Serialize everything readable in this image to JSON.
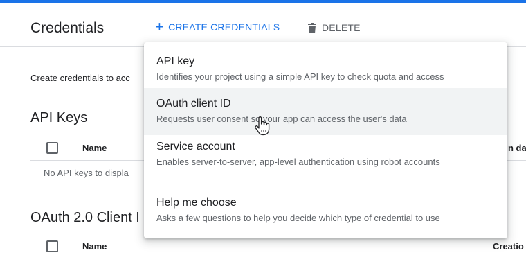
{
  "header": {
    "title": "Credentials",
    "create_label": "CREATE CREDENTIALS",
    "create_icon": "plus-icon",
    "delete_label": "DELETE",
    "delete_icon": "trash-icon"
  },
  "page": {
    "intro_text": "Create credentials to acc",
    "api_keys": {
      "heading": "API Keys",
      "columns": [
        "Name",
        "n da"
      ],
      "empty_text": "No API keys to displa"
    },
    "oauth": {
      "heading": "OAuth 2.0 Client I",
      "columns": [
        "Name",
        "Creatio"
      ]
    }
  },
  "menu": {
    "items": [
      {
        "title": "API key",
        "description": "Identifies your project using a simple API key to check quota and access"
      },
      {
        "title": "OAuth client ID",
        "description": "Requests user consent so your app can access the user's data"
      },
      {
        "title": "Service account",
        "description": "Enables server-to-server, app-level authentication using robot accounts"
      },
      {
        "title": "Help me choose",
        "description": "Asks a few questions to help you decide which type of credential to use"
      }
    ]
  },
  "colors": {
    "accent": "#1a73e8",
    "text": "#202124",
    "secondary_text": "#5f6368",
    "hover": "#f1f3f4"
  },
  "cursor_icon": "hand-pointer-icon"
}
